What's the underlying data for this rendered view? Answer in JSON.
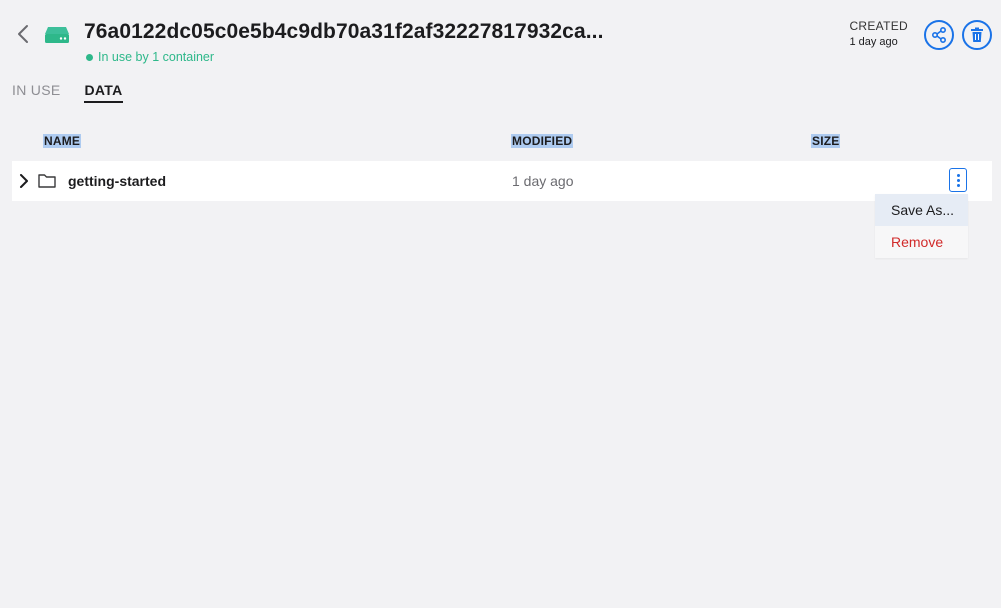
{
  "header": {
    "title": "76a0122dc05c0e5b4c9db70a31f2af32227817932ca...",
    "status": "In use by 1 container",
    "created_label": "CREATED",
    "created_value": "1 day ago",
    "back_icon": "chevron-left-icon",
    "volume_icon": "hard-drive-icon",
    "share_icon": "share-icon",
    "delete_icon": "trash-icon"
  },
  "tabs": [
    {
      "label": "IN USE",
      "active": false
    },
    {
      "label": "DATA",
      "active": true
    }
  ],
  "table": {
    "columns": [
      "NAME",
      "MODIFIED",
      "SIZE"
    ],
    "rows": [
      {
        "name": "getting-started",
        "modified": "1 day ago",
        "size": ""
      }
    ]
  },
  "context_menu": {
    "items": [
      {
        "label": "Save As..."
      },
      {
        "label": "Remove"
      }
    ]
  },
  "colors": {
    "accent": "#1a73e8",
    "status_green": "#2eb88a",
    "danger": "#d12a2a",
    "selection": "#aecbf0"
  }
}
